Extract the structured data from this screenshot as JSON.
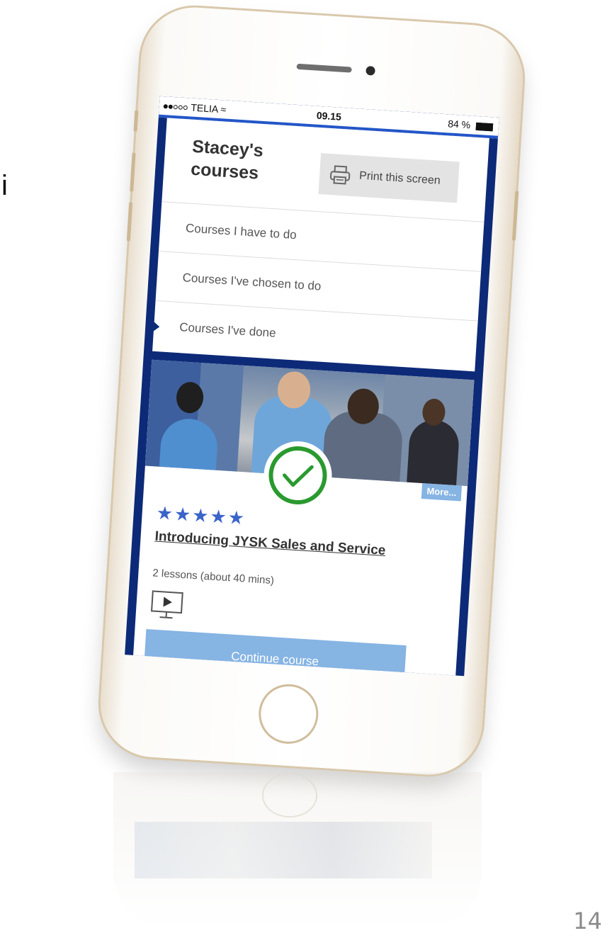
{
  "slide": {
    "side_glyph": "i",
    "page_number": "14"
  },
  "status_bar": {
    "carrier": "TELIA",
    "time": "09.15",
    "battery": "84 %"
  },
  "header": {
    "title": "Stacey's courses",
    "print_label": "Print this screen"
  },
  "menu": {
    "items": [
      {
        "label": "Courses I have to do"
      },
      {
        "label": "Courses I've chosen to do"
      },
      {
        "label": "Courses I've done",
        "active": true
      }
    ]
  },
  "course": {
    "more_label": "More...",
    "rating": "★★★★★",
    "rating_value": 5,
    "title": "Introducing JYSK Sales and Service",
    "lessons": "2 lessons (about 40 mins)",
    "continue_label": "Continue course",
    "completed": true
  },
  "colors": {
    "frame_blue": "#0d2a78",
    "accent_light_blue": "#86b4e3",
    "check_green": "#2a9a2f",
    "star_blue": "#3a64c8"
  },
  "icons": [
    "printer-icon",
    "checkmark-icon",
    "video-icon",
    "wifi-icon",
    "battery-icon"
  ]
}
